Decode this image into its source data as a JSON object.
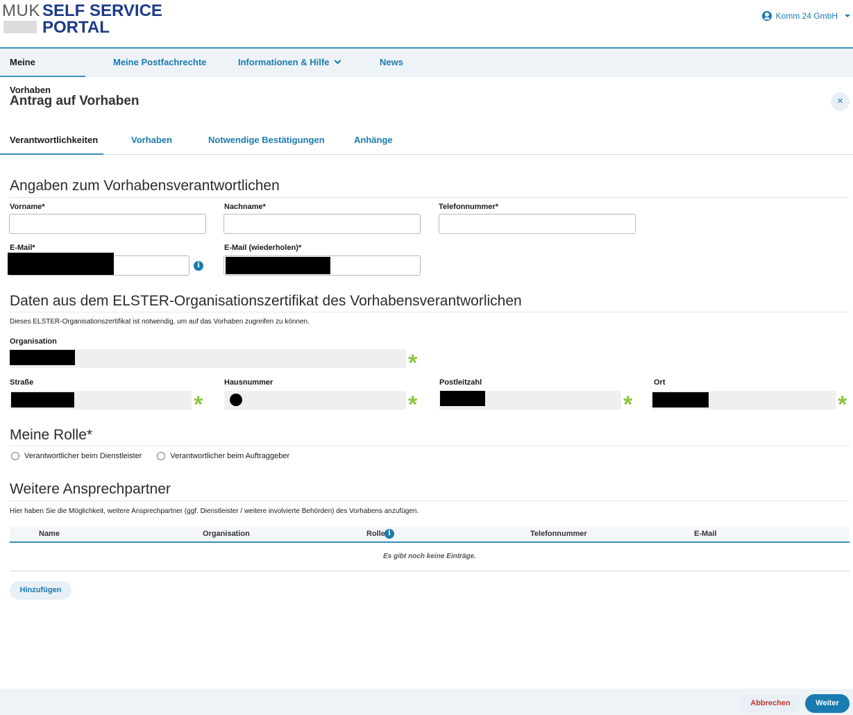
{
  "header": {
    "logo_muk": "MUK",
    "logo_self_service": "SELF SERVICE",
    "logo_portal": "PORTAL",
    "user_name": "Komm 24 GmbH"
  },
  "nav": {
    "items": [
      {
        "label": "Meine Vorhaben",
        "active": true
      },
      {
        "label": "Meine Postfachrechte",
        "active": false
      },
      {
        "label": "Informationen & Hilfe",
        "active": false,
        "has_dropdown": true
      },
      {
        "label": "News",
        "active": false
      }
    ]
  },
  "page": {
    "title": "Antrag auf Vorhaben",
    "close_icon": "×"
  },
  "tabs": [
    {
      "label": "Verantwortlichkeiten",
      "active": true
    },
    {
      "label": "Vorhaben",
      "active": false
    },
    {
      "label": "Notwendige Bestätigungen",
      "active": false
    },
    {
      "label": "Anhänge",
      "active": false
    }
  ],
  "responsible": {
    "title": "Angaben zum Vorhabensverantwortlichen",
    "first_name_label": "Vorname*",
    "first_name_value": "",
    "last_name_label": "Nachname*",
    "last_name_value": "",
    "phone_label": "Telefonnummer*",
    "phone_value": "",
    "email_label": "E-Mail*",
    "email_repeat_label": "E-Mail (wiederholen)*",
    "info_icon": "i"
  },
  "elster": {
    "title": "Daten aus dem ELSTER-Organisationszertifikat des Vorhabensverantworlichen",
    "description": "Dieses ELSTER-Organisationszertifikat ist notwendig, um auf das Vorhaben zugreifen zu können.",
    "organisation_label": "Organisation",
    "street_label": "Straße",
    "house_number_label": "Hausnummer",
    "postal_code_label": "Postleitzahl",
    "city_label": "Ort",
    "required_mark": "*"
  },
  "role": {
    "title": "Meine Rolle*",
    "options": [
      {
        "label": "Verantwortlicher beim Dienstleister",
        "selected": false
      },
      {
        "label": "Verantwortlicher beim Auftraggeber",
        "selected": false
      }
    ]
  },
  "contacts": {
    "title": "Weitere Ansprechpartner",
    "description": "Hier haben Sie die Möglichkeit, weitere Ansprechpartner (ggf. Dienstleister / weitere involvierte Behörden) des Vorhabens anzufügen.",
    "columns": [
      "Name",
      "Organisation",
      "Rolle",
      "Telefonnummer",
      "E-Mail"
    ],
    "empty_text": "Es gibt noch keine Einträge.",
    "add_label": "Hinzufügen"
  },
  "footer": {
    "cancel_label": "Abbrechen",
    "next_label": "Weiter"
  },
  "colors": {
    "brand_blue": "#1d3a8a",
    "link_blue": "#1a7bb0",
    "accent_line": "#3a8fbf",
    "required_green": "#8dc63f",
    "nav_bg": "#eef3f8"
  }
}
